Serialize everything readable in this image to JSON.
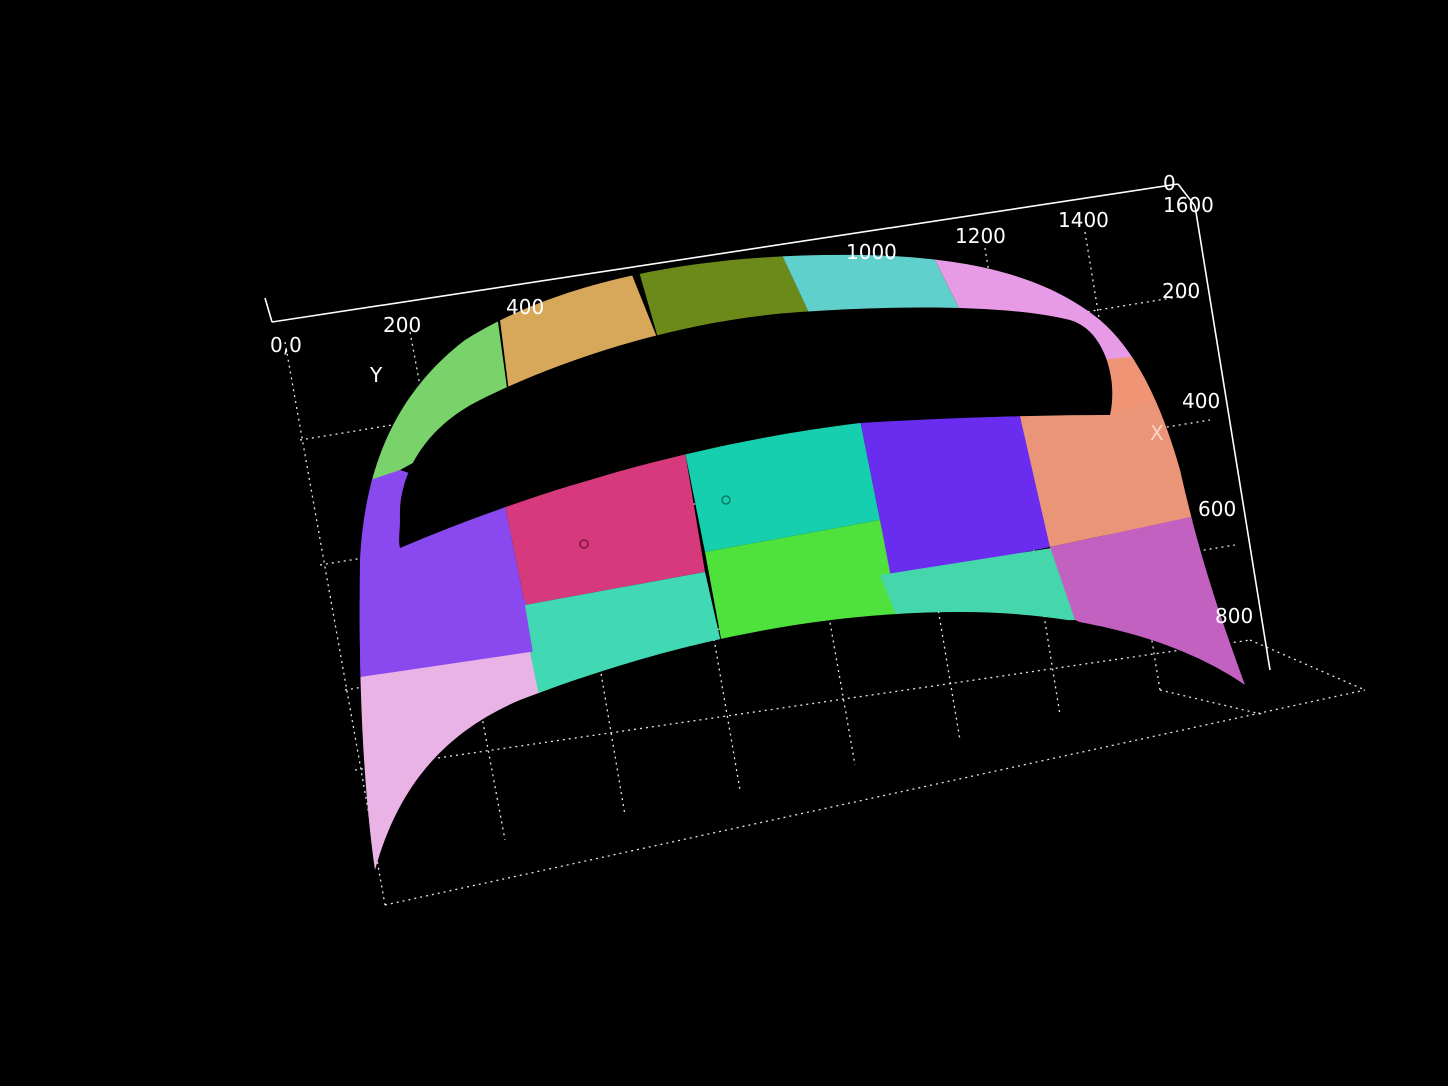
{
  "axes": {
    "origin_label": "0,0",
    "y_axis_label": "Y",
    "x_axis_label": "X",
    "top_ticks": [
      "200",
      "400",
      "1000",
      "1200",
      "1400",
      "1600"
    ],
    "top_right_tick": "0",
    "right_ticks": [
      "200",
      "400",
      "600",
      "800"
    ]
  },
  "surface": {
    "description_icon": "hood-surface-icon",
    "patch_colors": {
      "band_1": "#7ad36a",
      "band_2": "#d8a85a",
      "band_3": "#6b8a1a",
      "band_4": "#5fd0cc",
      "band_5": "#e79be6",
      "band_6": "#ef9475",
      "mid_1": "#8a49ef",
      "mid_2": "#d6397c",
      "mid_3": "#16cfae",
      "mid_4": "#6a2cef",
      "mid_5": "#ea9478",
      "low_1": "#8a49ef",
      "low_2": "#40d9b4",
      "low_3": "#4fe23d",
      "low_4": "#45d6ac",
      "low_5": "#c261bf",
      "bottom_1": "#eab3e6",
      "bottom_2": "#40d9b4"
    }
  }
}
